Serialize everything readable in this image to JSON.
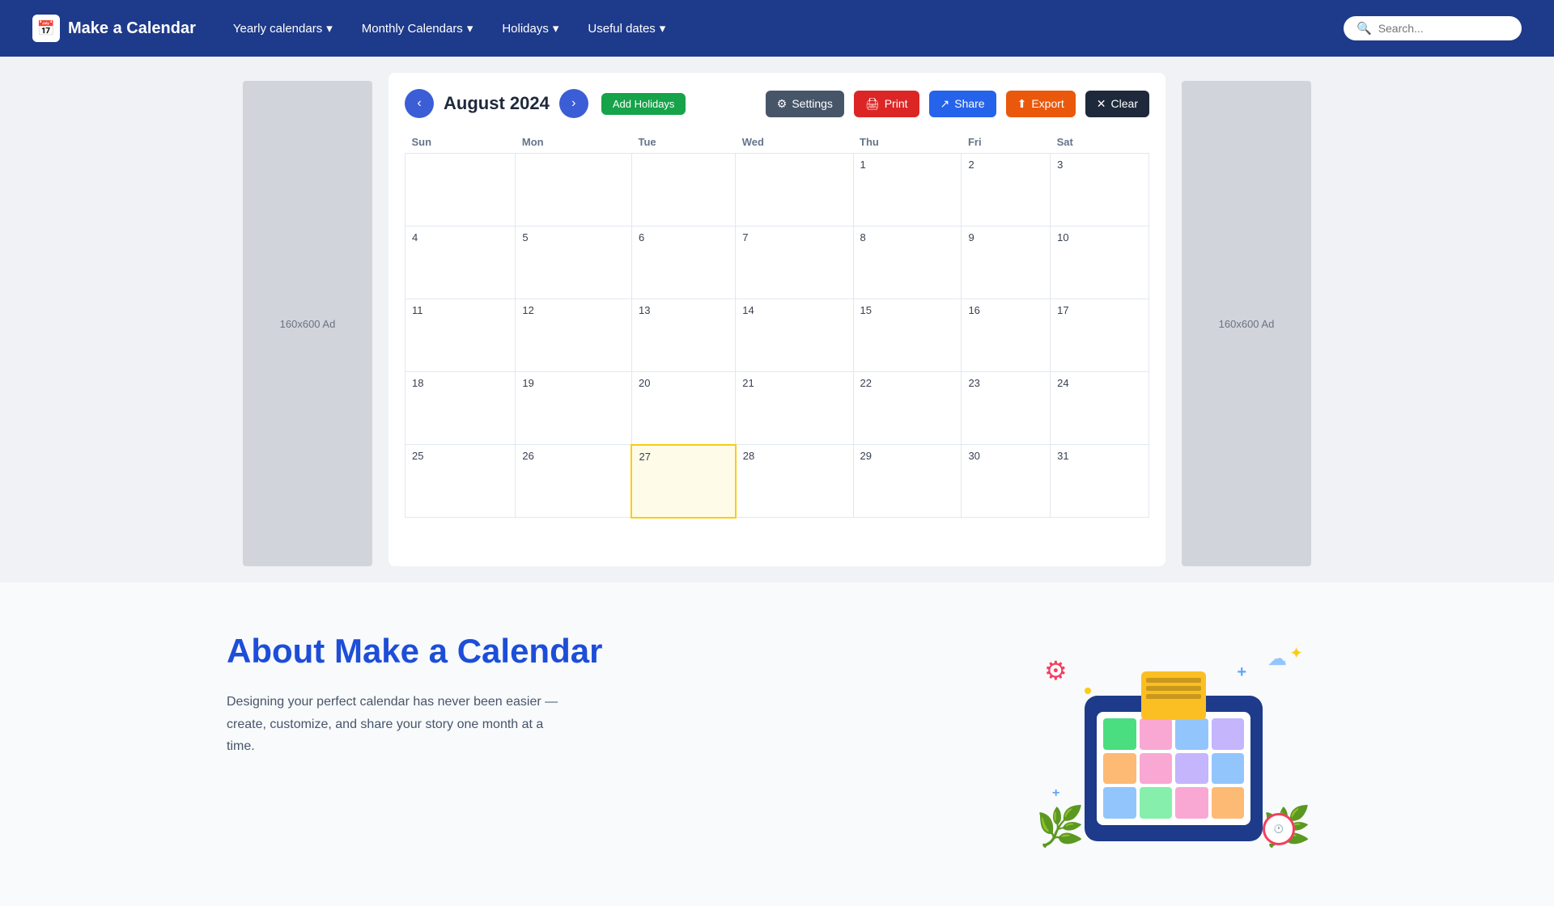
{
  "nav": {
    "logo_text": "Make a Calendar",
    "logo_icon": "📅",
    "items": [
      {
        "label": "Yearly calendars",
        "has_dropdown": true
      },
      {
        "label": "Monthly Calendars",
        "has_dropdown": true
      },
      {
        "label": "Holidays",
        "has_dropdown": true
      },
      {
        "label": "Useful dates",
        "has_dropdown": true
      }
    ],
    "search_placeholder": "Search..."
  },
  "toolbar": {
    "prev_label": "‹",
    "next_label": "›",
    "month_title": "August 2024",
    "add_holidays_label": "Add Holidays",
    "settings_label": "Settings",
    "print_label": "Print",
    "share_label": "Share",
    "export_label": "Export",
    "clear_label": "Clear"
  },
  "calendar": {
    "headers": [
      "Sun",
      "Mon",
      "Tue",
      "Wed",
      "Thu",
      "Fri",
      "Sat"
    ],
    "weeks": [
      [
        {
          "day": "",
          "empty": true
        },
        {
          "day": "",
          "empty": true
        },
        {
          "day": "",
          "empty": true
        },
        {
          "day": "",
          "empty": true
        },
        {
          "day": "1",
          "empty": false
        },
        {
          "day": "2",
          "empty": false
        },
        {
          "day": "3",
          "empty": false
        }
      ],
      [
        {
          "day": "4",
          "empty": false
        },
        {
          "day": "5",
          "empty": false
        },
        {
          "day": "6",
          "empty": false
        },
        {
          "day": "7",
          "empty": false
        },
        {
          "day": "8",
          "empty": false
        },
        {
          "day": "9",
          "empty": false
        },
        {
          "day": "10",
          "empty": false
        }
      ],
      [
        {
          "day": "11",
          "empty": false
        },
        {
          "day": "12",
          "empty": false
        },
        {
          "day": "13",
          "empty": false
        },
        {
          "day": "14",
          "empty": false
        },
        {
          "day": "15",
          "empty": false
        },
        {
          "day": "16",
          "empty": false
        },
        {
          "day": "17",
          "empty": false
        }
      ],
      [
        {
          "day": "18",
          "empty": false
        },
        {
          "day": "19",
          "empty": false
        },
        {
          "day": "20",
          "empty": false
        },
        {
          "day": "21",
          "empty": false
        },
        {
          "day": "22",
          "empty": false
        },
        {
          "day": "23",
          "empty": false
        },
        {
          "day": "24",
          "empty": false
        }
      ],
      [
        {
          "day": "25",
          "empty": false
        },
        {
          "day": "26",
          "empty": false
        },
        {
          "day": "27",
          "empty": false,
          "today": true
        },
        {
          "day": "28",
          "empty": false
        },
        {
          "day": "29",
          "empty": false
        },
        {
          "day": "30",
          "empty": false
        },
        {
          "day": "31",
          "empty": false
        }
      ]
    ]
  },
  "ad_panels": {
    "left_label": "160x600 Ad",
    "right_label": "160x600 Ad"
  },
  "about": {
    "title_plain": "About ",
    "title_colored": "Make a Calendar",
    "description": "Designing your perfect calendar has never been easier — create, customize, and share your story one month at a time."
  }
}
